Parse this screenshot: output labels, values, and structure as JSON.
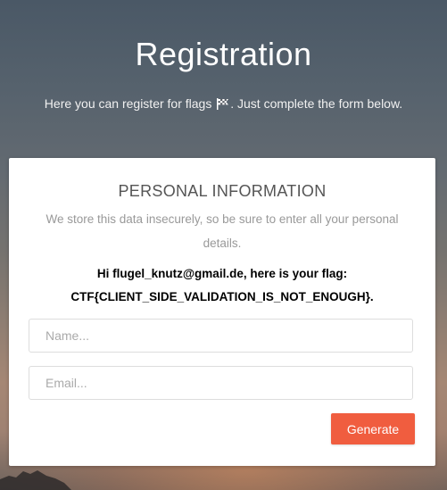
{
  "page": {
    "title": "Registration",
    "subtitle_before": "Here you can register for flags",
    "subtitle_after": ". Just complete the form below."
  },
  "card": {
    "heading": "PERSONAL INFORMATION",
    "description": "We store this data insecurely, so be sure to enter all your personal details.",
    "flag_line1": "Hi flugel_knutz@gmail.de, here is your flag:",
    "flag_line2": "CTF{CLIENT_SIDE_VALIDATION_IS_NOT_ENOUGH}."
  },
  "form": {
    "name_placeholder": "Name...",
    "name_value": "",
    "email_placeholder": "Email...",
    "email_value": "",
    "submit_label": "Generate"
  },
  "colors": {
    "accent": "#f05d3f",
    "card_bg": "#ffffff"
  },
  "icons": {
    "subtitle_icon": "flag-icon"
  }
}
